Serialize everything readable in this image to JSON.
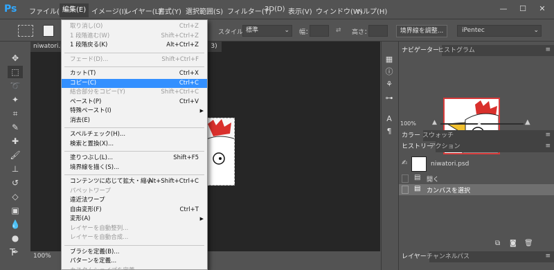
{
  "app": {
    "logo": "Ps"
  },
  "menubar": {
    "items": [
      "ファイル(F)",
      "編集(E)",
      "イメージ(I)",
      "レイヤー(L)",
      "書式(Y)",
      "選択範囲(S)",
      "フィルター(T)",
      "3D(D)",
      "表示(V)",
      "ウィンドウ(W)",
      "ヘルプ(H)"
    ],
    "active_index": 1,
    "window_controls": [
      "—",
      "☐",
      "✕"
    ]
  },
  "optionsbar": {
    "style_label": "スタイル：",
    "style_value": "標準",
    "width_label": "幅：",
    "height_label": "高さ：",
    "refine_button": "境界線を調整...",
    "workspace": "iPentec"
  },
  "document": {
    "tab_title": "niwatori.p",
    "tab2_title": "3)",
    "zoom": "100%"
  },
  "navigator": {
    "tabs": [
      "ナビゲーター",
      "ヒストグラム"
    ],
    "zoom": "100%"
  },
  "color_panel": {
    "tabs": [
      "カラー",
      "スウォッチ"
    ]
  },
  "history_panel": {
    "tabs": [
      "ヒストリー",
      "アクション"
    ],
    "snapshot": "niwatori.psd",
    "states": [
      "開く",
      "カンバスを選択"
    ],
    "selected_index": 1
  },
  "layers_panel": {
    "tabs": [
      "レイヤー",
      "チャンネル",
      "パス"
    ]
  },
  "edit_menu": {
    "items": [
      {
        "label": "取り消し(O)",
        "shortcut": "Ctrl+Z",
        "disabled": true
      },
      {
        "label": "1 段階進む(W)",
        "shortcut": "Shift+Ctrl+Z",
        "disabled": true
      },
      {
        "label": "1 段階戻る(K)",
        "shortcut": "Alt+Ctrl+Z",
        "disabled": false
      },
      {
        "sep": true
      },
      {
        "label": "フェード(D)...",
        "shortcut": "Shift+Ctrl+F",
        "disabled": true
      },
      {
        "sep": true
      },
      {
        "label": "カット(T)",
        "shortcut": "Ctrl+X",
        "disabled": false
      },
      {
        "label": "コピー(C)",
        "shortcut": "Ctrl+C",
        "disabled": false,
        "highlight": true
      },
      {
        "label": "結合部分をコピー(Y)",
        "shortcut": "Shift+Ctrl+C",
        "disabled": true
      },
      {
        "label": "ペースト(P)",
        "shortcut": "Ctrl+V",
        "disabled": false
      },
      {
        "label": "特殊ペースト(I)",
        "shortcut": "",
        "disabled": false,
        "submenu": true
      },
      {
        "label": "消去(E)",
        "shortcut": "",
        "disabled": false
      },
      {
        "sep": true
      },
      {
        "label": "スペルチェック(H)...",
        "shortcut": "",
        "disabled": false
      },
      {
        "label": "検索と置換(X)...",
        "shortcut": "",
        "disabled": false
      },
      {
        "sep": true
      },
      {
        "label": "塗りつぶし(L)...",
        "shortcut": "Shift+F5",
        "disabled": false
      },
      {
        "label": "境界線を描く(S)...",
        "shortcut": "",
        "disabled": false
      },
      {
        "sep": true
      },
      {
        "label": "コンテンツに応じて拡大・縮小",
        "shortcut": "Alt+Shift+Ctrl+C",
        "disabled": false
      },
      {
        "label": "パペットワープ",
        "shortcut": "",
        "disabled": true
      },
      {
        "label": "遠近法ワープ",
        "shortcut": "",
        "disabled": false
      },
      {
        "label": "自由変形(F)",
        "shortcut": "Ctrl+T",
        "disabled": false
      },
      {
        "label": "変形(A)",
        "shortcut": "",
        "disabled": false,
        "submenu": true
      },
      {
        "label": "レイヤーを自動整列...",
        "shortcut": "",
        "disabled": true
      },
      {
        "label": "レイヤーを自動合成...",
        "shortcut": "",
        "disabled": true
      },
      {
        "sep": true
      },
      {
        "label": "ブラシを定義(B)...",
        "shortcut": "",
        "disabled": false
      },
      {
        "label": "パターンを定義...",
        "shortcut": "",
        "disabled": false
      },
      {
        "label": "カスタムシェイプを定義...",
        "shortcut": "",
        "disabled": true
      }
    ]
  },
  "colors": {
    "highlight": "#3390ff",
    "accent": "#31a8ff"
  }
}
